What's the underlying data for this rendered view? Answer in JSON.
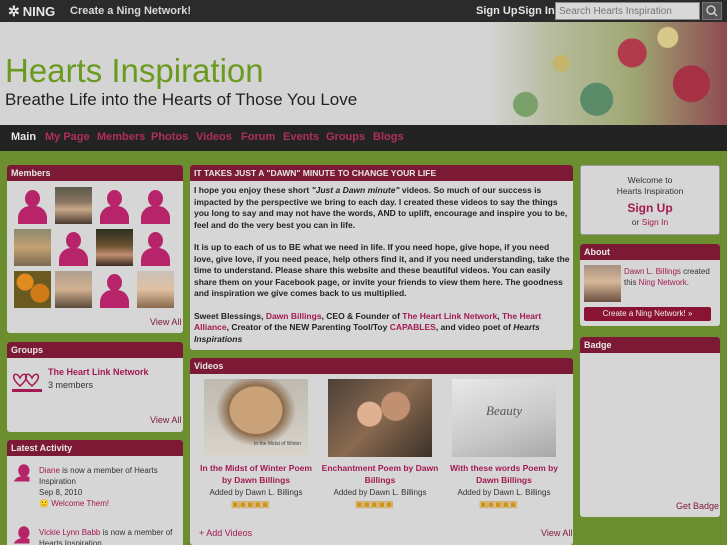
{
  "topbar": {
    "logo": "NING",
    "create_link": "Create a Ning Network!",
    "signup": "Sign Up",
    "signin": "Sign In",
    "search_placeholder": "Search Hearts Inspiration"
  },
  "header": {
    "title": "Hearts Inspiration",
    "tagline": "Breathe Life into the Hearts of Those You Love"
  },
  "nav": {
    "items": [
      "Main",
      "My Page",
      "Members",
      "Photos",
      "Videos",
      "Forum",
      "Events",
      "Groups",
      "Blogs"
    ]
  },
  "members": {
    "heading": "Members",
    "view_all": "View All"
  },
  "groups": {
    "heading": "Groups",
    "group_name": "The Heart Link Network",
    "group_count": "3 members",
    "view_all": "View All"
  },
  "activity": {
    "heading": "Latest Activity",
    "item1_name": "Diane",
    "item1_text": " is now a member of Hearts Inspiration",
    "item1_date": "Sep 8, 2010",
    "item1_link": "Welcome Them!",
    "item2_name": "Vickie Lynn Babb",
    "item2_text": " is now a member of Hearts Inspiration"
  },
  "feature": {
    "heading": "IT TAKES JUST A \"DAWN\" MINUTE TO CHANGE YOUR LIFE",
    "p1_a": "I hope you enjoy these short ",
    "p1_em": "\"Just a Dawn minute\"",
    "p1_b": " videos. So much of our success is impacted by the perspective we bring to each day. I created these videos to say the things you long to say and may not have the words, AND to uplift, encourage and inspire you to be, feel and do the very best you can in life.",
    "p2": "It is up to each of us to BE what we need in life. If you need hope, give hope, if you need love, give love, if you need peace, help others find it, and if you need understanding, take the time to understand. Please share this website and these beautiful videos. You can easily share them on your Facebook page, or invite your friends to view them here. The goodness and inspiration we give comes back to us multiplied.",
    "p3_a": "Sweet Blessings, ",
    "p3_name": "Dawn Billings",
    "p3_b": ", CEO & Founder of ",
    "p3_link1": "The Heart Link Network",
    "p3_c": ", ",
    "p3_link2": "The Heart Alliance",
    "p3_d": ", Creator of the NEW Parenting Tool/Toy ",
    "p3_link3": "CAPABLES",
    "p3_e": ", and video poet of ",
    "p3_em": "Hearts Inspirations"
  },
  "videos": {
    "heading": "Videos",
    "items": [
      {
        "title": "In the Midst of Winter Poem by Dawn Billings",
        "added": "Added by Dawn L. Billings",
        "thumb_caption": "In the Midst of Winter"
      },
      {
        "title": "Enchantment Poem by Dawn Billings",
        "added": "Added by Dawn L. Billings",
        "thumb_caption": ""
      },
      {
        "title": "With these words Poem by Dawn Billings",
        "added": "Added by Dawn L. Billings",
        "thumb_caption": "Beauty"
      }
    ],
    "add": "+ Add Videos",
    "view_all": "View All"
  },
  "welcome": {
    "line1": "Welcome to",
    "line2": "Hearts Inspiration",
    "signup": "Sign Up",
    "or": "or ",
    "signin": "Sign In"
  },
  "about": {
    "heading": "About",
    "name": "Dawn L. Billings",
    "text1": " created this ",
    "link": "Ning Network",
    "text2": ".",
    "button": "Create a Ning Network! »"
  },
  "badge": {
    "heading": "Badge",
    "get": "Get Badge"
  },
  "colors": {
    "accent": "#7c1a36",
    "link": "#a21a52",
    "title_green": "#6a9a1f",
    "bg_green": "#6b8f2e"
  }
}
